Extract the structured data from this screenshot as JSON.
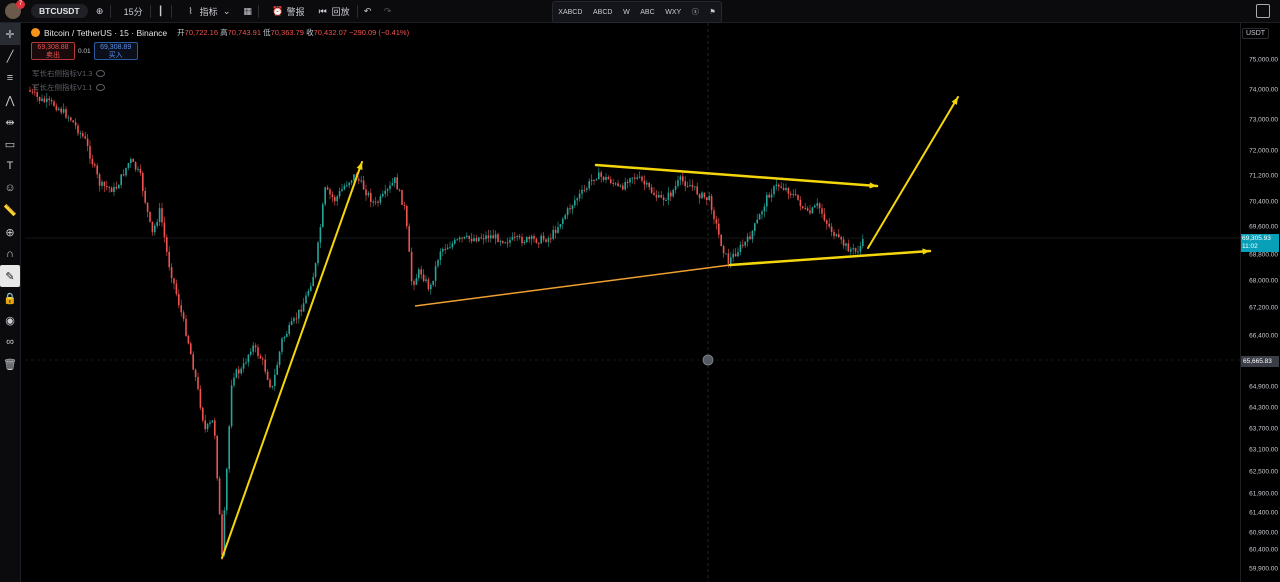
{
  "topbar": {
    "badge_count": "7",
    "symbol": "BTCUSDT",
    "interval": "15分",
    "indicators_label": "指标",
    "alert_label": "警报",
    "replay_label": "回放"
  },
  "patterns": [
    "XABCD",
    "ABCD",
    "W",
    "ABC",
    "WXY",
    "",
    ""
  ],
  "legend": {
    "title": "Bitcoin / TetherUS · 15 · Binance",
    "open_k": "开",
    "open_v": "70,722.16",
    "high_k": "高",
    "high_v": "70,743.91",
    "low_k": "低",
    "low_v": "70,363.79",
    "close_k": "收",
    "close_v": "70,432.07",
    "change": "−290.09 (−0.41%)"
  },
  "trade": {
    "sell_price": "69,308.88",
    "sell_label": "卖出",
    "spread": "0.01",
    "buy_price": "69,308.89",
    "buy_label": "买入"
  },
  "indicators": [
    "军长右侧指标V1.3",
    "军长左侧指标V1.1"
  ],
  "axis": {
    "currency": "USDT",
    "labels": [
      "75,000.00",
      "74,000.00",
      "73,000.00",
      "72,000.00",
      "71,200.00",
      "70,400.00",
      "69,600.00",
      "68,800.00",
      "68,000.00",
      "67,200.00",
      "66,400.00",
      "64,900.00",
      "64,300.00",
      "63,700.00",
      "63,100.00",
      "62,500.00",
      "61,900.00",
      "61,400.00",
      "60,900.00",
      "60,400.00",
      "59,900.00"
    ],
    "current_price": "69,305.93",
    "current_time": "11:02",
    "crosshair_price": "65,665.83"
  },
  "colors": {
    "up": "#26a69a",
    "down": "#ef5350",
    "drawing": "#f5d60a",
    "accent": "#089fb8"
  }
}
